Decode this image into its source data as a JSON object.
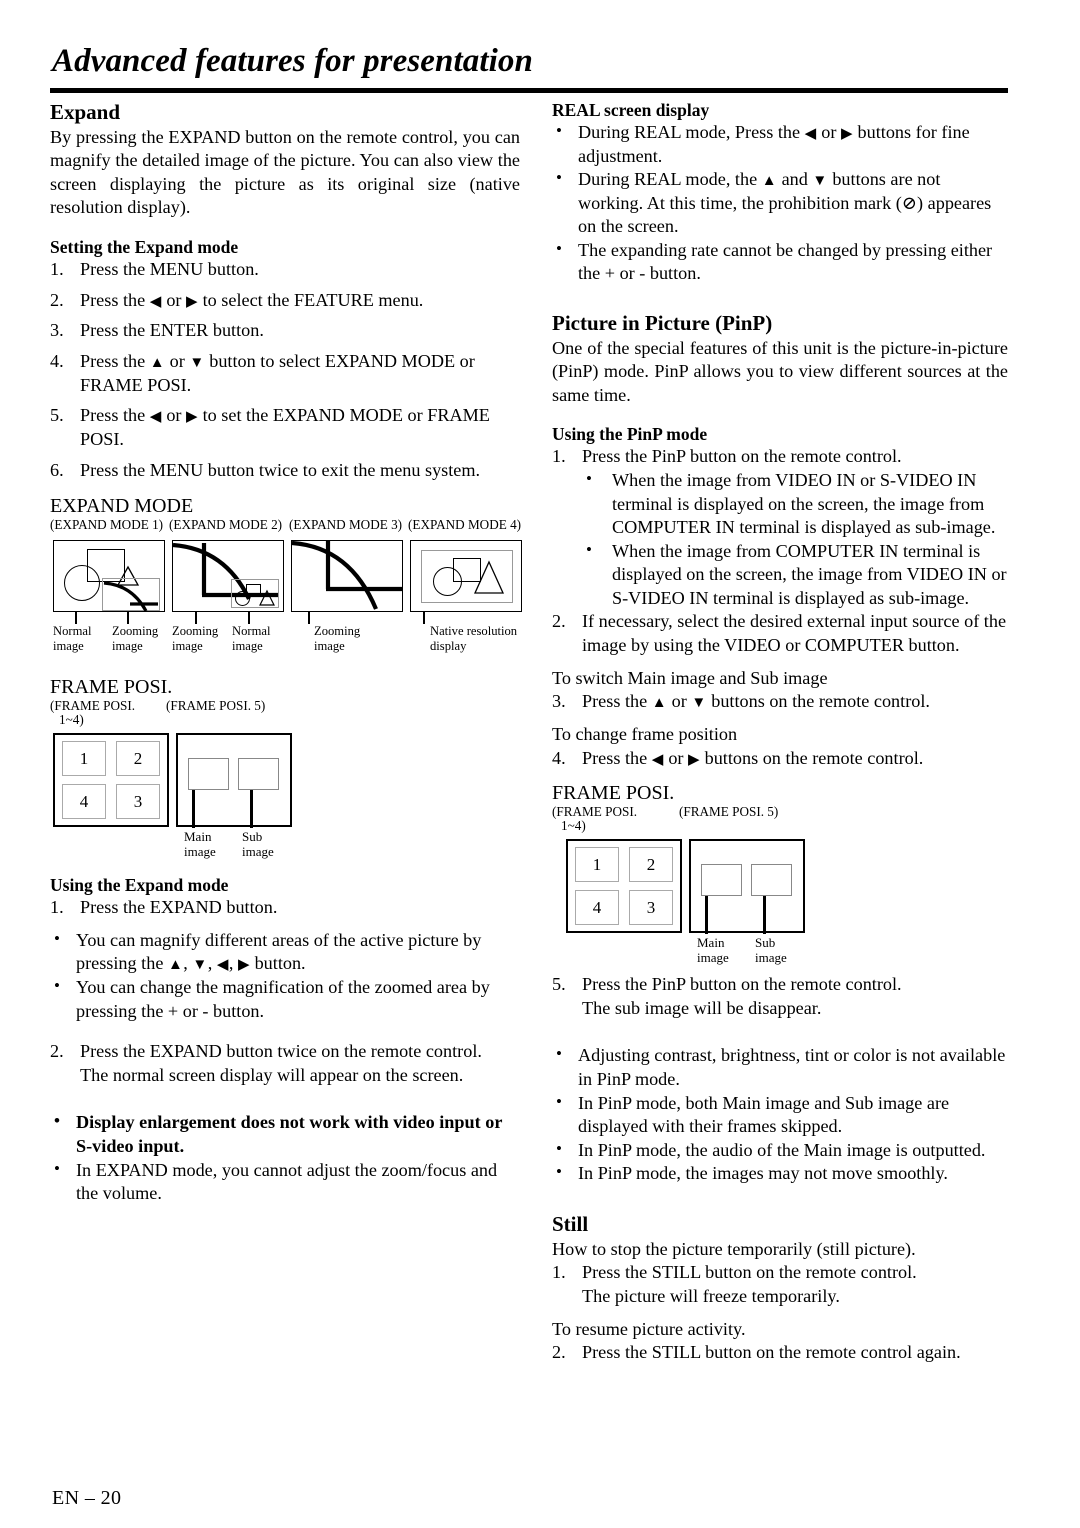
{
  "page": {
    "title": "Advanced features for presentation",
    "footer": "EN – 20"
  },
  "left_column": {
    "expand": {
      "heading": "Expand",
      "intro": "By pressing the EXPAND button on the remote control, you can magnify the detailed image of the picture. You can also view the screen displaying the picture as its original size (native resolution display).",
      "setting_heading": "Setting the Expand mode",
      "steps": [
        {
          "num": "1.",
          "text": "Press the MENU button."
        },
        {
          "num": "2.",
          "pre": "Press the ",
          "mid": " or ",
          "post": " to select the FEATURE menu.",
          "icons": [
            "left-arrow",
            "right-arrow"
          ]
        },
        {
          "num": "3.",
          "text": "Press the ENTER button."
        },
        {
          "num": "4.",
          "pre": "Press the ",
          "mid": " or ",
          "post": " button to select EXPAND MODE or FRAME POSI.",
          "icons": [
            "up-arrow",
            "down-arrow"
          ]
        },
        {
          "num": "5.",
          "pre": "Press the ",
          "mid": " or ",
          "post": " to set the EXPAND MODE or FRAME POSI.",
          "icons": [
            "left-arrow",
            "right-arrow"
          ]
        },
        {
          "num": "6.",
          "text": "Press the MENU button twice to exit the menu system."
        }
      ]
    },
    "expand_mode_figure": {
      "title": "EXPAND MODE",
      "modes": [
        {
          "label": "(EXPAND MODE 1)",
          "captions": [
            "Normal image",
            "Zooming image"
          ]
        },
        {
          "label": "(EXPAND MODE 2)",
          "captions": [
            "Zooming image",
            "Normal image"
          ]
        },
        {
          "label": "(EXPAND MODE 3)",
          "captions": [
            "Zooming image"
          ]
        },
        {
          "label": "(EXPAND MODE 4)",
          "captions": [
            "Native resolution display"
          ]
        }
      ],
      "caption_texts": {
        "normal_1": "Normal",
        "normal_2": "image",
        "zooming_1": "Zooming",
        "zooming_2": "image",
        "native_1": "Native resolution",
        "native_2": "display"
      }
    },
    "frame_posi_figure": {
      "title": "FRAME POSI.",
      "sub_left_line1": "(FRAME POSI.",
      "sub_left_line2": "1~4)",
      "sub_right": "(FRAME POSI. 5)",
      "quadrants": [
        "1",
        "2",
        "4",
        "3"
      ],
      "main_label_1": "Main",
      "main_label_2": "image",
      "sub_label_1": "Sub",
      "sub_label_2": "image"
    },
    "using_expand": {
      "heading": "Using the Expand mode",
      "step1_num": "1.",
      "step1_text": "Press the EXPAND button.",
      "bullets": [
        {
          "pre": "You can magnify different areas of the active picture by pressing the ",
          "icons": [
            "up-arrow",
            "down-arrow",
            "left-arrow",
            "right-arrow"
          ],
          "post": " button."
        },
        {
          "text": "You can change the magnification of the zoomed area by pressing the + or - button."
        }
      ],
      "step2_num": "2.",
      "step2_text": "Press the EXPAND button twice on the remote control.",
      "step2_extra": "The normal screen display will appear on the screen.",
      "notes": [
        {
          "text": "Display enlargement does not work with video input or S-video input.",
          "bold": true
        },
        {
          "text": "In EXPAND mode, you cannot adjust the zoom/focus and the volume.",
          "bold": false
        }
      ]
    }
  },
  "right_column": {
    "real_screen": {
      "heading": "REAL screen display",
      "bullets": [
        {
          "pre": "During REAL mode, Press the ",
          "mid": " or ",
          "post": " buttons for fine adjustment.",
          "icons": [
            "left-arrow",
            "right-arrow"
          ]
        },
        {
          "pre": "During REAL mode, the ",
          "mid": " and ",
          "post": " buttons are not working. At this time, the prohibition mark (⊘) appeares on the screen.",
          "icons": [
            "up-arrow",
            "down-arrow"
          ]
        },
        {
          "text": "The expanding rate cannot be changed by pressing either the + or - button."
        }
      ]
    },
    "pinp": {
      "heading": "Picture in Picture (PinP)",
      "intro": "One of the special features of this unit is the picture-in-picture (PinP) mode. PinP allows you to view different sources at the same time.",
      "using_heading": "Using the PinP mode",
      "step1_num": "1.",
      "step1_text": "Press the PinP button on the remote control.",
      "step1_bullets": [
        "When the image from VIDEO IN or S-VIDEO IN terminal is displayed on the screen, the image from COMPUTER IN terminal is displayed as sub-image.",
        "When the image from COMPUTER IN terminal is displayed on the screen, the image from VIDEO IN or S-VIDEO IN terminal is displayed as sub-image."
      ],
      "step2_num": "2.",
      "step2_text": "If necessary, select the desired external input source of the image by using the VIDEO or COMPUTER button.",
      "switch_line": "To switch Main image and Sub image",
      "step3_num": "3.",
      "step3_pre": "Press the ",
      "step3_mid": " or ",
      "step3_post": " buttons on the remote control.",
      "step3_icons": [
        "up-arrow",
        "down-arrow"
      ],
      "frame_line": "To change frame position",
      "step4_num": "4.",
      "step4_pre": "Press the ",
      "step4_mid": " or ",
      "step4_post": " buttons on the remote control.",
      "step4_icons": [
        "left-arrow",
        "right-arrow"
      ],
      "step5_num": "5.",
      "step5_text": "Press the PinP button on the remote control.",
      "step5_extra": "The sub image will be disappear.",
      "notes": [
        "Adjusting contrast, brightness, tint or color is not available in PinP mode.",
        "In PinP mode, both Main image and Sub image are displayed with their frames skipped.",
        "In PinP mode, the audio of the Main image is outputted.",
        "In PinP mode, the images may not move smoothly."
      ]
    },
    "frame_posi_figure": {
      "title": "FRAME POSI.",
      "sub_left_line1": "(FRAME POSI.",
      "sub_left_line2": "1~4)",
      "sub_right": "(FRAME POSI. 5)",
      "quadrants": [
        "1",
        "2",
        "4",
        "3"
      ],
      "main_label_1": "Main",
      "main_label_2": "image",
      "sub_label_1": "Sub",
      "sub_label_2": "image"
    },
    "still": {
      "heading": "Still",
      "intro": "How to stop the picture temporarily (still picture).",
      "step1_num": "1.",
      "step1_text": "Press the STILL button on the remote control.",
      "step1_extra": "The picture will freeze temporarily.",
      "resume_line": "To resume picture activity.",
      "step2_num": "2.",
      "step2_text": "Press the STILL button on the remote control again."
    }
  }
}
